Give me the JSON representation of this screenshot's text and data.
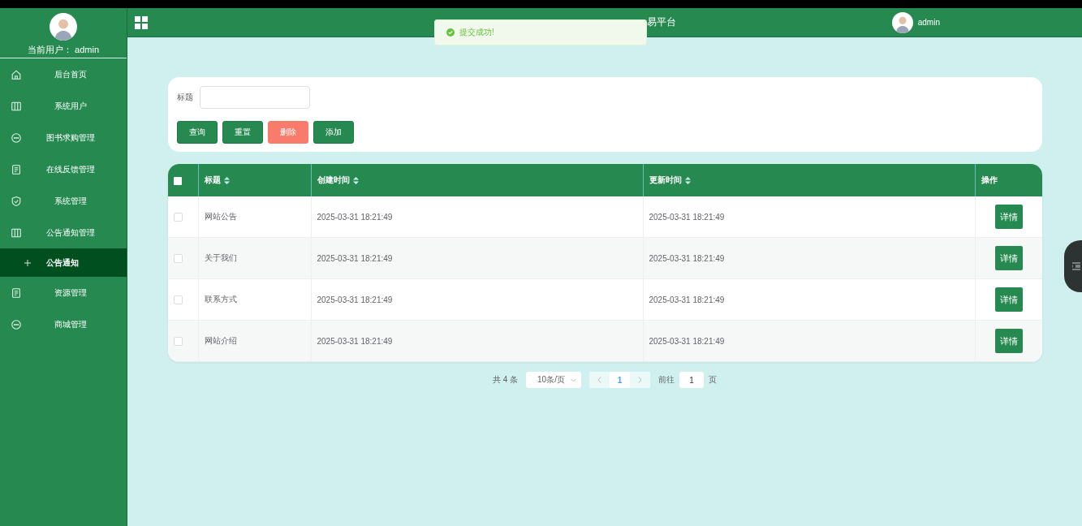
{
  "sidebar": {
    "current_user_label": "当前用户：",
    "current_user": "admin",
    "items": [
      {
        "label": "后台首页",
        "kind": "home",
        "selected": false
      },
      {
        "label": "系统用户",
        "kind": "columns",
        "selected": false
      },
      {
        "label": "图书求购管理",
        "kind": "chat",
        "selected": false
      },
      {
        "label": "在线反馈管理",
        "kind": "doc",
        "selected": false
      },
      {
        "label": "系统管理",
        "kind": "shield",
        "selected": false
      },
      {
        "label": "公告通知管理",
        "kind": "columns",
        "selected": false,
        "children": [
          {
            "label": "公告通知",
            "selected": true
          }
        ]
      },
      {
        "label": "资源管理",
        "kind": "doc",
        "selected": false
      },
      {
        "label": "商城管理",
        "kind": "chat",
        "selected": false
      }
    ]
  },
  "header": {
    "title": "易平台",
    "user": "admin"
  },
  "toast": {
    "message": "提交成功!"
  },
  "search": {
    "label": "标题"
  },
  "buttons": [
    {
      "label": "查询",
      "kind": "primary"
    },
    {
      "label": "重置",
      "kind": "primary"
    },
    {
      "label": "删除",
      "kind": "danger"
    },
    {
      "label": "添加",
      "kind": "primary"
    }
  ],
  "table": {
    "all_checked": false,
    "columns": [
      {
        "label": "标题",
        "sortable": true
      },
      {
        "label": "创建时间",
        "sortable": true
      },
      {
        "label": "更新时间",
        "sortable": true
      },
      {
        "label": "操作",
        "sortable": false
      }
    ],
    "rows": [
      {
        "title": "网站公告",
        "created": "2025-03-31 18:21:49",
        "updated": "2025-03-31 18:21:49",
        "action": "详情",
        "checked": false
      },
      {
        "title": "关于我们",
        "created": "2025-03-31 18:21:49",
        "updated": "2025-03-31 18:21:49",
        "action": "详情",
        "checked": false
      },
      {
        "title": "联系方式",
        "created": "2025-03-31 18:21:49",
        "updated": "2025-03-31 18:21:49",
        "action": "详情",
        "checked": false
      },
      {
        "title": "网站介绍",
        "created": "2025-03-31 18:21:49",
        "updated": "2025-03-31 18:21:49",
        "action": "详情",
        "checked": false
      }
    ]
  },
  "pagination": {
    "total": "共 4 条",
    "page_size": "10条/页",
    "pages": [
      {
        "label": "1",
        "selected": true
      }
    ],
    "goto_label": "前往",
    "goto_value": "1",
    "goto_suffix": "页"
  }
}
